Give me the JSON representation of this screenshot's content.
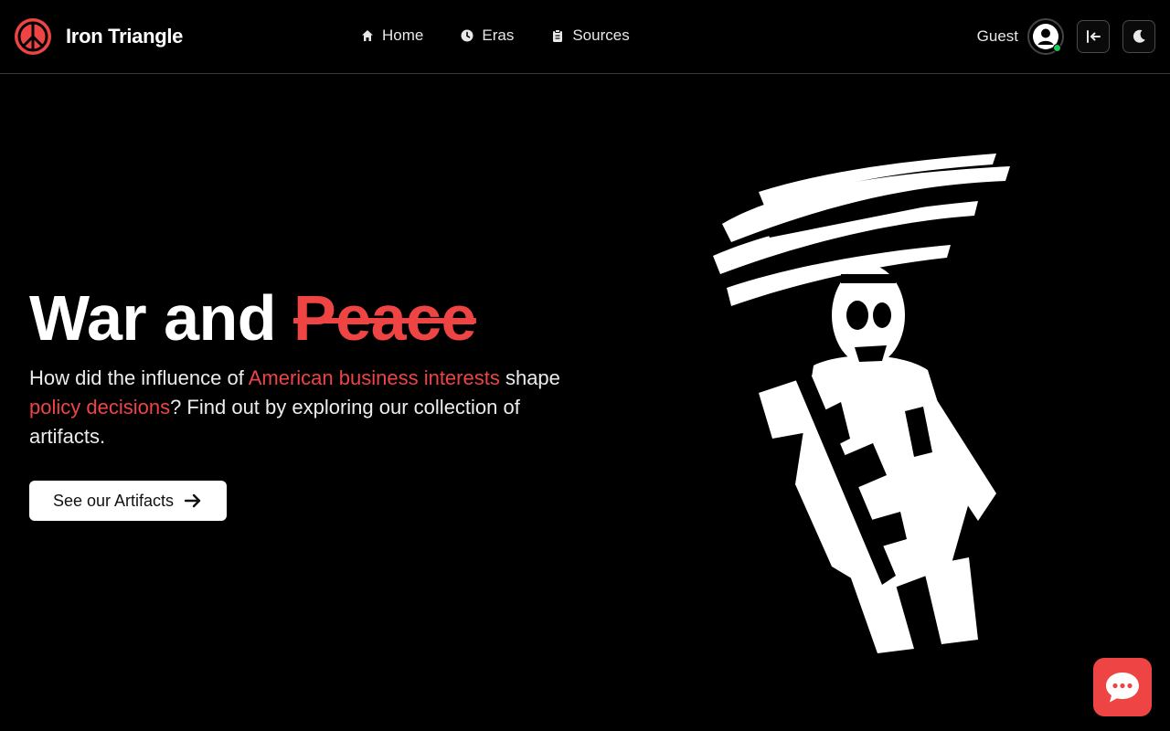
{
  "brand": {
    "name": "Iron Triangle",
    "logo_icon": "peace-sign-icon",
    "accent": "#ef4444"
  },
  "nav": {
    "items": [
      {
        "label": "Home",
        "icon": "home-icon"
      },
      {
        "label": "Eras",
        "icon": "clock-icon"
      },
      {
        "label": "Sources",
        "icon": "clipboard-icon"
      }
    ]
  },
  "user": {
    "name": "Guest",
    "status_color": "#22c55e"
  },
  "toolbar": {
    "collapse_icon": "collapse-left-icon",
    "theme_icon": "moon-icon"
  },
  "hero": {
    "title_prefix": "War and ",
    "title_struck": "Peace",
    "text_1": "How did the influence of ",
    "highlight_1": "American business interests",
    "text_2": " shape ",
    "highlight_2": "policy decisions",
    "text_3": "? Find out by exploring our collection of artifacts.",
    "cta_label": "See our Artifacts",
    "cta_icon": "arrow-right-icon"
  },
  "illustration": {
    "description_icon": "soldier-sketch-illustration"
  },
  "chat": {
    "icon": "chat-bubble-icon"
  }
}
